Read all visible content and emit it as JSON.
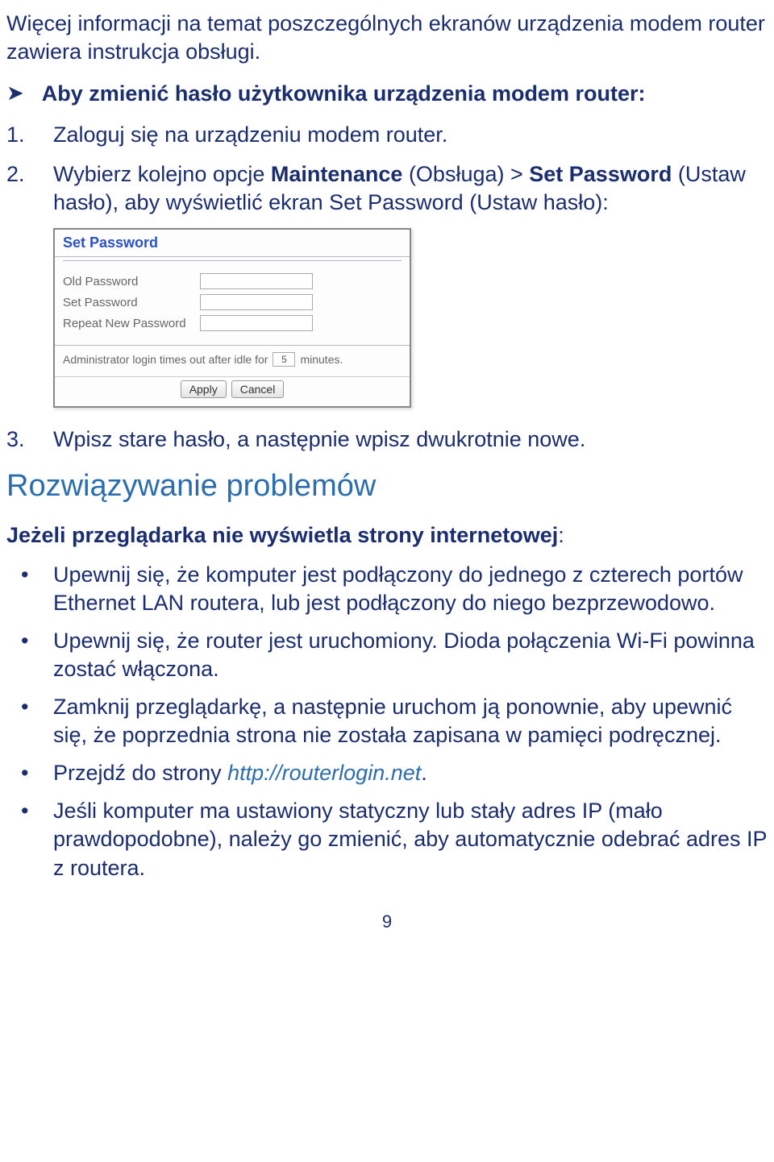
{
  "intro": "Więcej informacji na temat poszczególnych ekranów urządzenia modem router zawiera instrukcja obsługi.",
  "arrow_bullet": "Aby zmienić hasło użytkownika urządzenia modem router:",
  "steps": {
    "s1_num": "1.",
    "s1_txt": "Zaloguj się na urządzeniu modem router.",
    "s2_num": "2.",
    "s2_pre": "Wybierz kolejno opcje ",
    "s2_b1": "Maintenance",
    "s2_mid1": " (Obsługa) > ",
    "s2_b2": "Set Password",
    "s2_mid2": " (Ustaw hasło), aby wyświetlić ekran Set Password (Ustaw hasło):",
    "s3_num": "3.",
    "s3_txt": "Wpisz stare hasło, a następnie wpisz dwukrotnie nowe."
  },
  "screenshot": {
    "title": "Set Password",
    "old": "Old Password",
    "set": "Set Password",
    "repeat": "Repeat New Password",
    "timeout_pre": "Administrator login times out after idle for",
    "timeout_val": "5",
    "timeout_post": "minutes.",
    "apply": "Apply",
    "cancel": "Cancel"
  },
  "h2": "Rozwiązywanie problemów",
  "sub_bold": "Jeżeli przeglądarka nie wyświetla strony internetowej",
  "sub_colon": ":",
  "bullets": {
    "b1": "Upewnij się, że komputer jest podłączony do jednego z czterech portów Ethernet LAN routera, lub jest podłączony do niego bezprzewodowo.",
    "b2": "Upewnij się, że router jest uruchomiony. Dioda połączenia Wi-Fi powinna zostać włączona.",
    "b3": "Zamknij przeglądarkę, a następnie uruchom ją ponownie, aby upewnić się, że poprzednia strona nie została zapisana w pamięci podręcznej.",
    "b4_pre": "Przejdź do strony ",
    "b4_link": "http://routerlogin.net",
    "b4_post": ".",
    "b5": "Jeśli komputer ma ustawiony statyczny lub stały adres IP (mało prawdopodobne), należy go zmienić, aby automatycznie odebrać adres IP z routera."
  },
  "page_num": "9"
}
